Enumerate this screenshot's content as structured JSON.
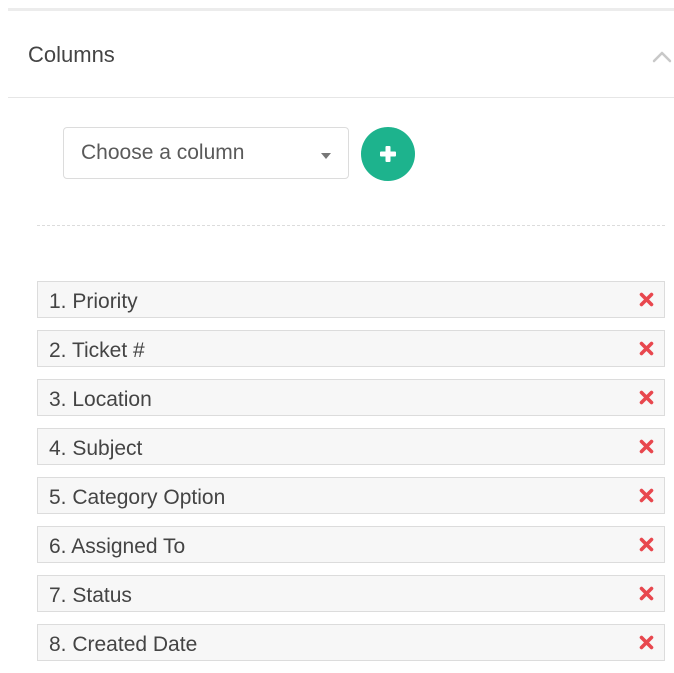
{
  "panel": {
    "title": "Columns",
    "collapse_icon": "chevron-up-icon"
  },
  "selector": {
    "placeholder": "Choose a column",
    "caret_icon": "caret-down-icon",
    "add_icon": "plus-icon"
  },
  "columns": [
    {
      "label": "1. Priority"
    },
    {
      "label": "2. Ticket #"
    },
    {
      "label": "3. Location"
    },
    {
      "label": "4. Subject"
    },
    {
      "label": "5. Category Option"
    },
    {
      "label": "6. Assigned To"
    },
    {
      "label": "7. Status"
    },
    {
      "label": "8. Created Date"
    }
  ],
  "colors": {
    "accent": "#1db38d",
    "remove": "#e8474e",
    "item_background": "#f7f7f7",
    "border": "#dcdcdc"
  }
}
